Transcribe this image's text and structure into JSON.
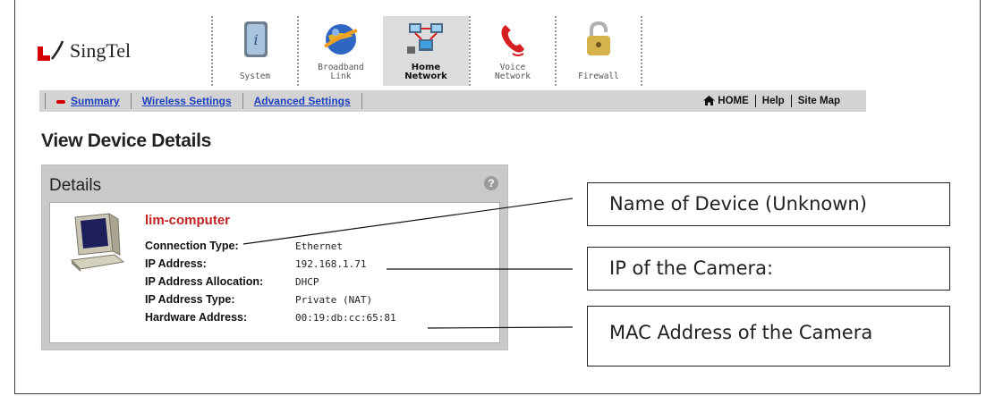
{
  "brand": {
    "name": "SingTel"
  },
  "nav": {
    "items": [
      {
        "label": "System",
        "icon": "system-icon",
        "active": false
      },
      {
        "label": "Broadband\nLink",
        "icon": "broadband-globe-icon",
        "active": false
      },
      {
        "label": "Home\nNetwork",
        "icon": "home-network-icon",
        "active": true
      },
      {
        "label": "Voice\nNetwork",
        "icon": "phone-icon",
        "active": false
      },
      {
        "label": "Firewall",
        "icon": "padlock-icon",
        "active": false
      }
    ]
  },
  "subnav": {
    "links": [
      "Summary",
      "Wireless Settings",
      "Advanced Settings"
    ],
    "right_links": [
      "HOME",
      "Help",
      "Site Map"
    ]
  },
  "page": {
    "title": "View Device Details"
  },
  "details": {
    "title": "Details",
    "help": "?",
    "device_name": "lim-computer",
    "rows": [
      {
        "label": "Connection Type:",
        "value": "Ethernet"
      },
      {
        "label": "IP Address:",
        "value": "192.168.1.71"
      },
      {
        "label": "IP Address Allocation:",
        "value": "DHCP"
      },
      {
        "label": "IP Address Type:",
        "value": "Private (NAT)"
      },
      {
        "label": "Hardware Address:",
        "value": "00:19:db:cc:65:81"
      }
    ]
  },
  "callouts": [
    "Name of Device (Unknown)",
    "IP of the Camera:",
    "MAC Address of the Camera"
  ],
  "colors": {
    "link": "#1a3fbf",
    "device_name": "#c22222",
    "bar": "#d3d3d3",
    "brand_red": "#d40000"
  }
}
